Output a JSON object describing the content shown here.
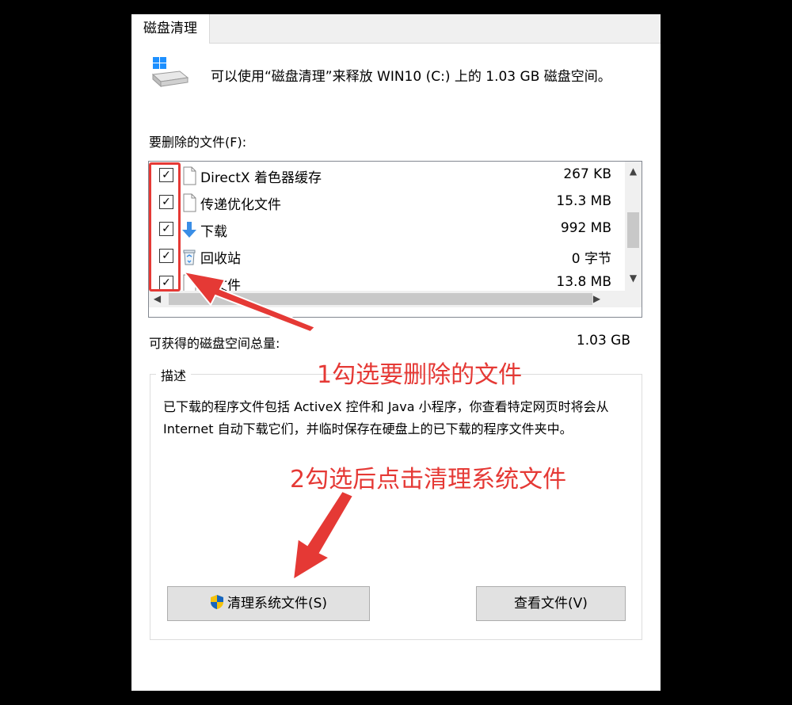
{
  "tab": {
    "label": "磁盘清理"
  },
  "intro": {
    "text": "可以使用“磁盘清理”来释放 WIN10 (C:) 上的 1.03 GB 磁盘空间。"
  },
  "files_label": "要删除的文件(F):",
  "files": [
    {
      "name": "DirectX 着色器缓存",
      "size": "267 KB",
      "checked": true,
      "icon": "file-icon"
    },
    {
      "name": "传递优化文件",
      "size": "15.3 MB",
      "checked": true,
      "icon": "file-icon"
    },
    {
      "name": "下载",
      "size": "992 MB",
      "checked": true,
      "icon": "download-arrow-icon"
    },
    {
      "name": "回收站",
      "size": "0 字节",
      "checked": true,
      "icon": "recycle-bin-icon"
    },
    {
      "name": "时文件",
      "size": "13.8 MB",
      "checked": true,
      "icon": "file-icon"
    }
  ],
  "checkmark": "✓",
  "total_label": "可获得的磁盘空间总量:",
  "total_value": "1.03 GB",
  "description": {
    "title": "描述",
    "text": "已下载的程序文件包括 ActiveX 控件和 Java 小程序，你查看特定网页时将会从 Internet 自动下载它们，并临时保存在硬盘上的已下载的程序文件夹中。"
  },
  "buttons": {
    "clean_system": "清理系统文件(S)",
    "view_files": "查看文件(V)"
  },
  "annotations": {
    "step1": "1勾选要删除的文件",
    "step2": "2勾选后点击清理系统文件"
  },
  "colors": {
    "annotation": "#e53935",
    "backdrop": "#000000",
    "accent_blue": "#3a8ee6"
  }
}
